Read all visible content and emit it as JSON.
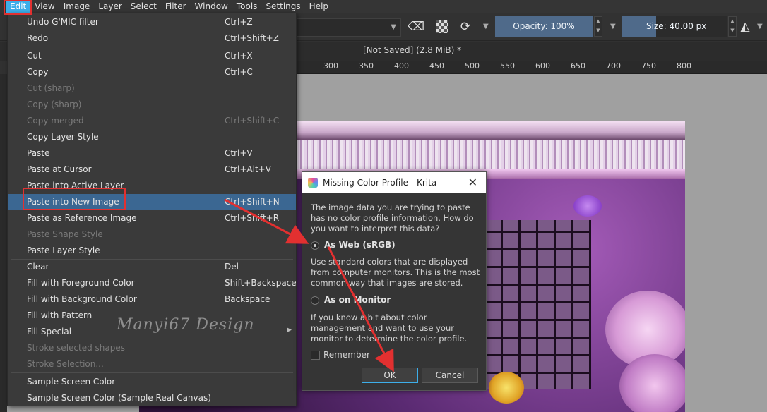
{
  "menubar": {
    "items": [
      "Edit",
      "View",
      "Image",
      "Layer",
      "Select",
      "Filter",
      "Window",
      "Tools",
      "Settings",
      "Help"
    ]
  },
  "toolbar": {
    "opacity_label": "Opacity: 100%",
    "size_label": "Size: 40.00 px"
  },
  "document": {
    "title": "[Not Saved]  (2.8 MiB) *"
  },
  "ruler": {
    "ticks": [
      "300",
      "350",
      "400",
      "450",
      "500",
      "550",
      "600",
      "650",
      "700",
      "750",
      "800"
    ]
  },
  "edit_menu": {
    "items": [
      {
        "label": "Undo G'MIC filter",
        "shortcut": "Ctrl+Z",
        "enabled": true
      },
      {
        "label": "Redo",
        "shortcut": "Ctrl+Shift+Z",
        "enabled": true
      },
      {
        "label": "Cut",
        "shortcut": "Ctrl+X",
        "enabled": true
      },
      {
        "label": "Copy",
        "shortcut": "Ctrl+C",
        "enabled": true
      },
      {
        "label": "Cut (sharp)",
        "shortcut": "",
        "enabled": false
      },
      {
        "label": "Copy (sharp)",
        "shortcut": "",
        "enabled": false
      },
      {
        "label": "Copy merged",
        "shortcut": "Ctrl+Shift+C",
        "enabled": false
      },
      {
        "label": "Copy Layer Style",
        "shortcut": "",
        "enabled": true
      },
      {
        "label": "Paste",
        "shortcut": "Ctrl+V",
        "enabled": true
      },
      {
        "label": "Paste at Cursor",
        "shortcut": "Ctrl+Alt+V",
        "enabled": true
      },
      {
        "label": "Paste into Active Layer",
        "shortcut": "",
        "enabled": true
      },
      {
        "label": "Paste into New Image",
        "shortcut": "Ctrl+Shift+N",
        "enabled": true,
        "highlighted": true
      },
      {
        "label": "Paste as Reference Image",
        "shortcut": "Ctrl+Shift+R",
        "enabled": true
      },
      {
        "label": "Paste Shape Style",
        "shortcut": "",
        "enabled": false
      },
      {
        "label": "Paste Layer Style",
        "shortcut": "",
        "enabled": true
      },
      {
        "label": "Clear",
        "shortcut": "Del",
        "enabled": true
      },
      {
        "label": "Fill with Foreground Color",
        "shortcut": "Shift+Backspace",
        "enabled": true
      },
      {
        "label": "Fill with Background Color",
        "shortcut": "Backspace",
        "enabled": true
      },
      {
        "label": "Fill with Pattern",
        "shortcut": "",
        "enabled": true
      },
      {
        "label": "Fill Special",
        "shortcut": "",
        "enabled": true,
        "submenu": true
      },
      {
        "label": "Stroke selected shapes",
        "shortcut": "",
        "enabled": false
      },
      {
        "label": "Stroke Selection...",
        "shortcut": "",
        "enabled": false
      },
      {
        "label": "Sample Screen Color",
        "shortcut": "",
        "enabled": true
      },
      {
        "label": "Sample Screen Color (Sample Real Canvas)",
        "shortcut": "",
        "enabled": true
      }
    ]
  },
  "watermark": "Manyi67 Design",
  "dialog": {
    "title": "Missing Color Profile - Krita",
    "message": "The image data you are trying to paste has no color profile information. How do you want to interpret this data?",
    "option_web": {
      "label": "As Web (sRGB)",
      "selected": true,
      "description": "Use standard colors that are displayed from computer monitors. This is the most common way that images are stored."
    },
    "option_monitor": {
      "label": "As on Monitor",
      "selected": false,
      "description": "If you know a bit about color management and want to use your monitor to determine the color profile."
    },
    "remember_label": "Remember",
    "remember_checked": false,
    "ok_label": "OK",
    "cancel_label": "Cancel"
  },
  "colors": {
    "highlight": "#3b6792",
    "annotation": "#e23030",
    "slider": "#4f6a8a",
    "menubar_active": "#3daee9"
  }
}
